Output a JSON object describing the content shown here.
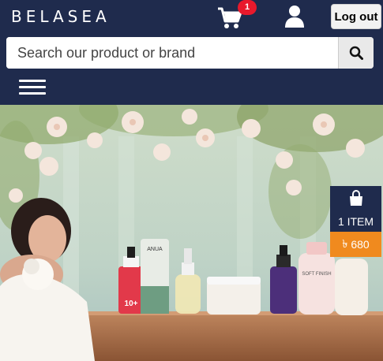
{
  "header": {
    "logo_text": "BELASEA",
    "cart_badge": "1",
    "logout_label": "Log out"
  },
  "search": {
    "placeholder": "Search our product or brand"
  },
  "banner": {
    "products": [
      {
        "label": "10+"
      },
      {
        "label": "ANUA"
      },
      {
        "label": ""
      },
      {
        "label": ""
      },
      {
        "label": ""
      },
      {
        "label": "SOFT FINISH"
      },
      {
        "label": ""
      }
    ]
  },
  "mini_cart": {
    "items_label": "1 ITEM",
    "currency": "৳",
    "total": "680"
  },
  "colors": {
    "header_bg": "#1f2b4d",
    "badge": "#e8192c",
    "mini_cart_total_bg": "#f08a1e"
  }
}
